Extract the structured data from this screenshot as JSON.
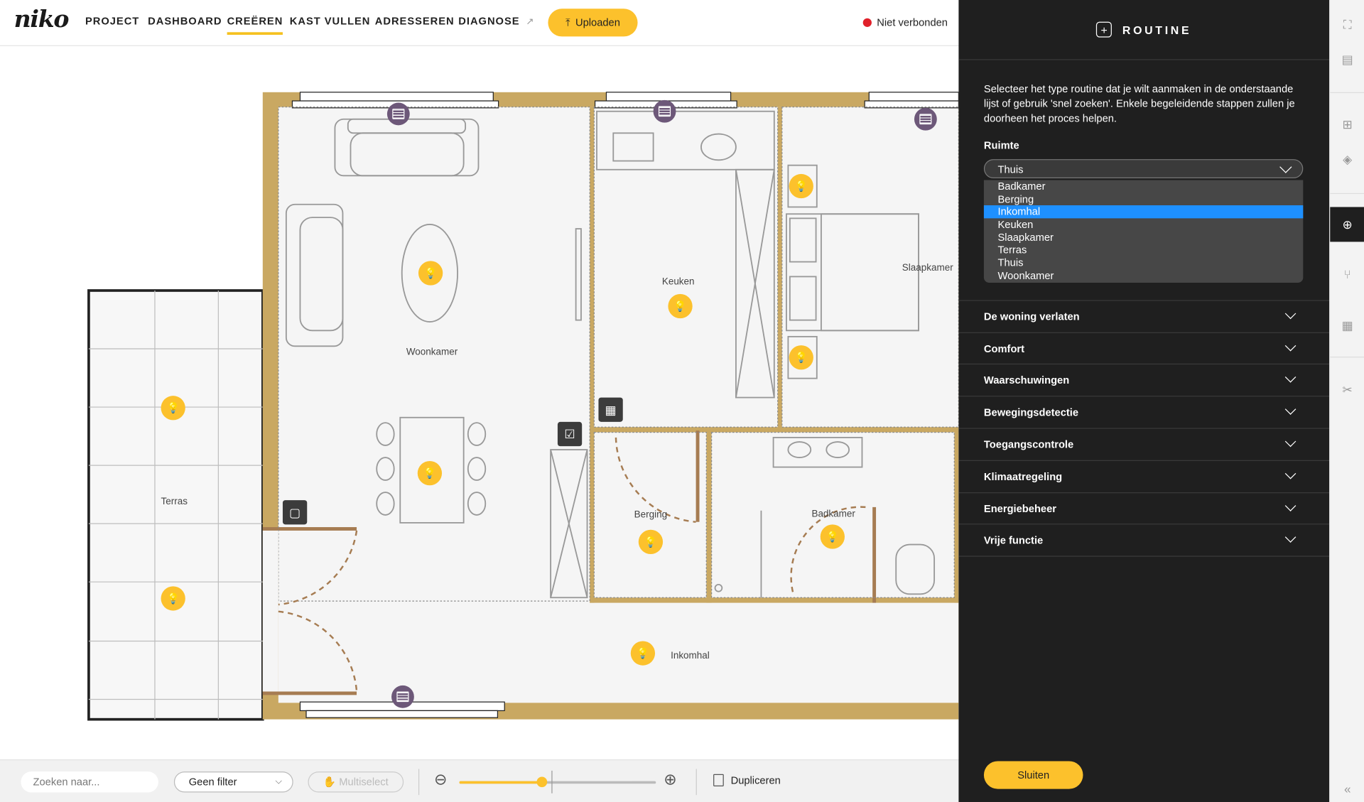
{
  "app": {
    "logo": "niko"
  },
  "nav": {
    "items": [
      {
        "label": "PROJECT"
      },
      {
        "label": "DASHBOARD"
      },
      {
        "label": "CREËREN",
        "active": true
      },
      {
        "label": "KAST VULLEN"
      },
      {
        "label": "ADRESSEREN"
      },
      {
        "label": "DIAGNOSE",
        "external": true
      }
    ],
    "upload_label": "Uploaden",
    "status_label": "Niet verbonden",
    "status_color": "#e0202a",
    "accent_color": "#fcc12c"
  },
  "floorplan": {
    "rooms": {
      "woonkamer": "Woonkamer",
      "keuken": "Keuken",
      "slaapkamer": "Slaapkamer",
      "terras": "Terras",
      "berging": "Berging",
      "badkamer": "Badkamer",
      "inkomhal": "Inkomhal"
    },
    "pin_icons": {
      "light": "lightbulb-icon",
      "shutter": "shutter-icon",
      "switch": "switch-icon"
    }
  },
  "bottombar": {
    "search_placeholder": "Zoeken naar...",
    "filter_value": "Geen filter",
    "multiselect_label": "Multiselect",
    "duplicate_label": "Dupliceren",
    "zoom_level": 0.42
  },
  "panel": {
    "title": "ROUTINE",
    "description": "Selecteer het type routine dat je wilt aanmaken in de onderstaande lijst of gebruik 'snel zoeken'. Enkele begeleidende stappen zullen je doorheen het proces helpen.",
    "ruimte_label": "Ruimte",
    "ruimte_value": "Thuis",
    "ruimte_options": [
      "Badkamer",
      "Berging",
      "Inkomhal",
      "Keuken",
      "Slaapkamer",
      "Terras",
      "Thuis",
      "Woonkamer"
    ],
    "highlighted_option": "Inkomhal",
    "sections": [
      "De woning verlaten",
      "Comfort",
      "Waarschuwingen",
      "Bewegingsdetectie",
      "Toegangscontrole",
      "Klimaatregeling",
      "Energiebeheer",
      "Vrije functie"
    ],
    "close_label": "Sluiten"
  }
}
